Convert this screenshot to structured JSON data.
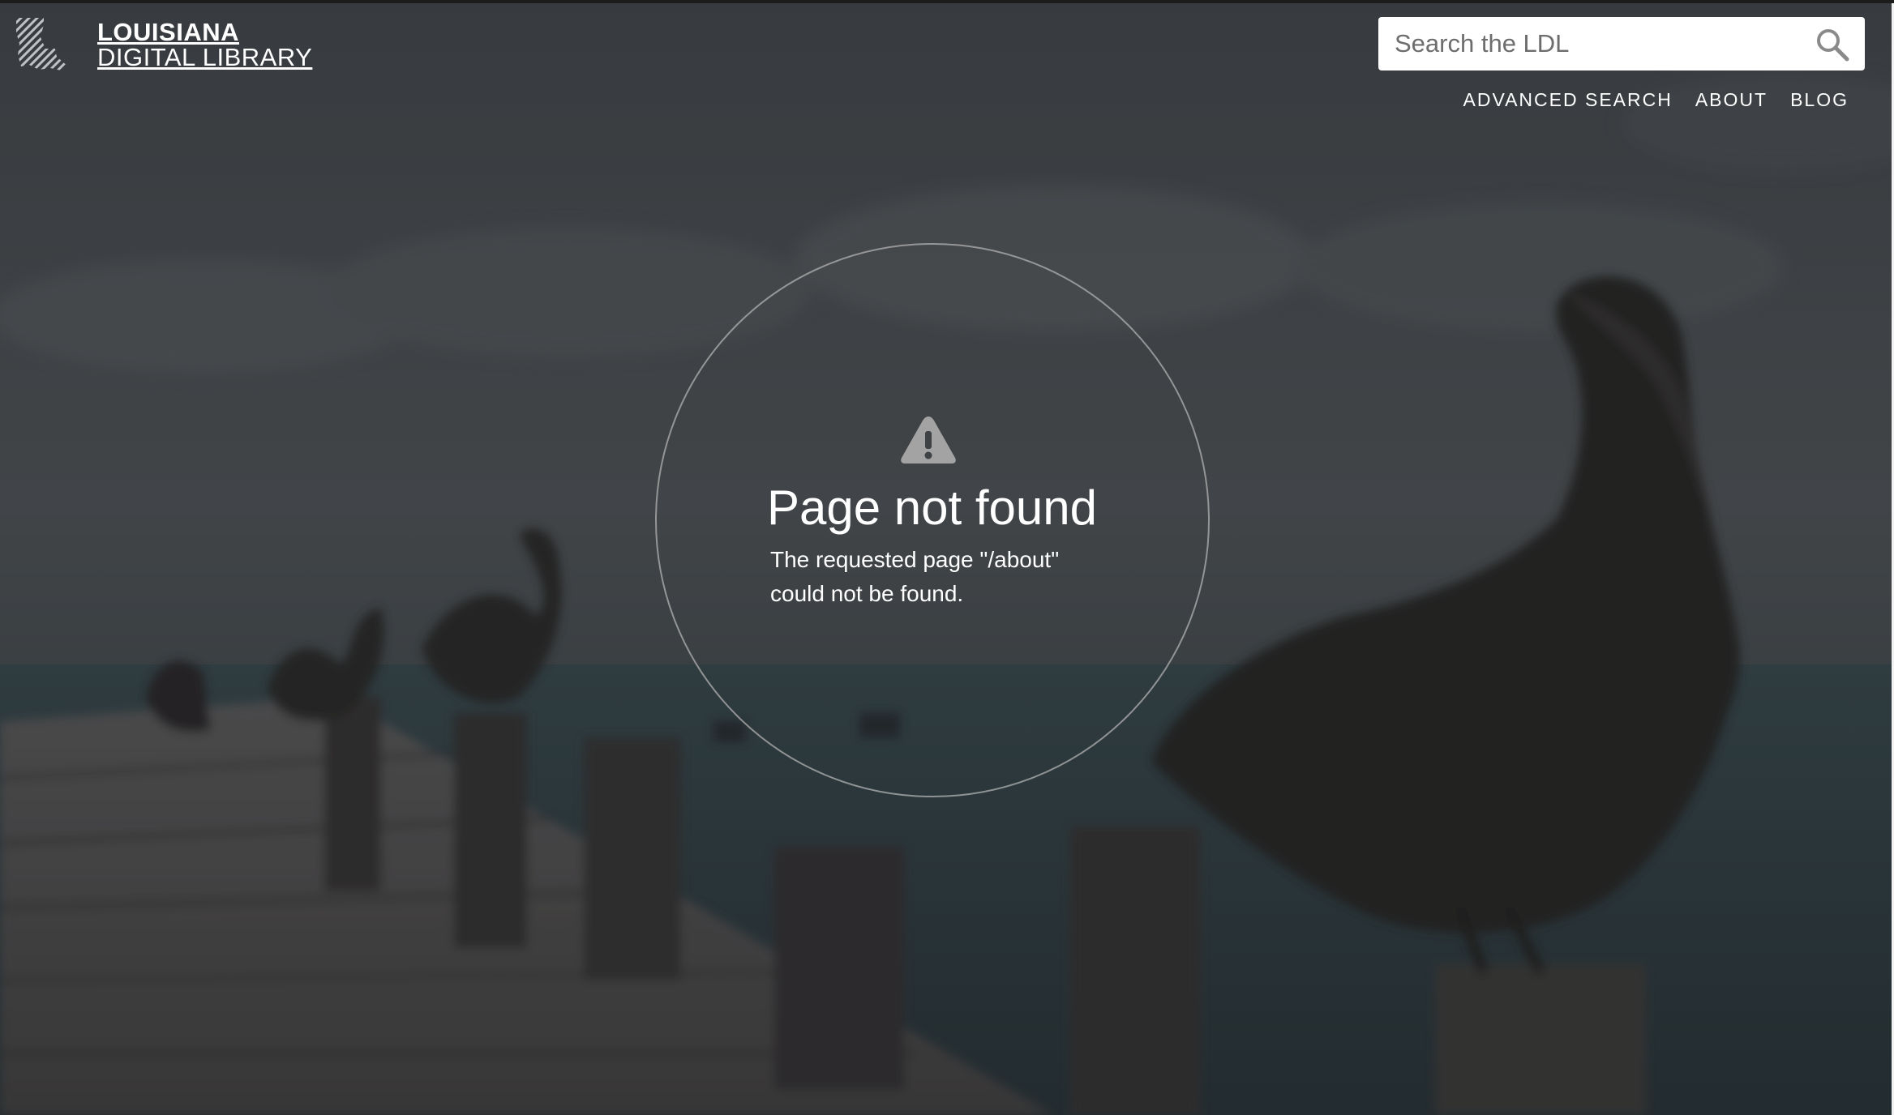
{
  "site": {
    "name_line1": "LOUISIANA",
    "name_line2": "DIGITAL LIBRARY"
  },
  "search": {
    "placeholder": "Search the LDL",
    "value": ""
  },
  "nav": {
    "items": [
      {
        "label": "ADVANCED SEARCH"
      },
      {
        "label": "ABOUT"
      },
      {
        "label": "BLOG"
      }
    ]
  },
  "error": {
    "title": "Page not found",
    "message": "The requested page \"/about\" could not be found."
  },
  "icons": {
    "logo": "louisiana-state-icon",
    "search": "search-icon",
    "warning": "warning-icon"
  }
}
